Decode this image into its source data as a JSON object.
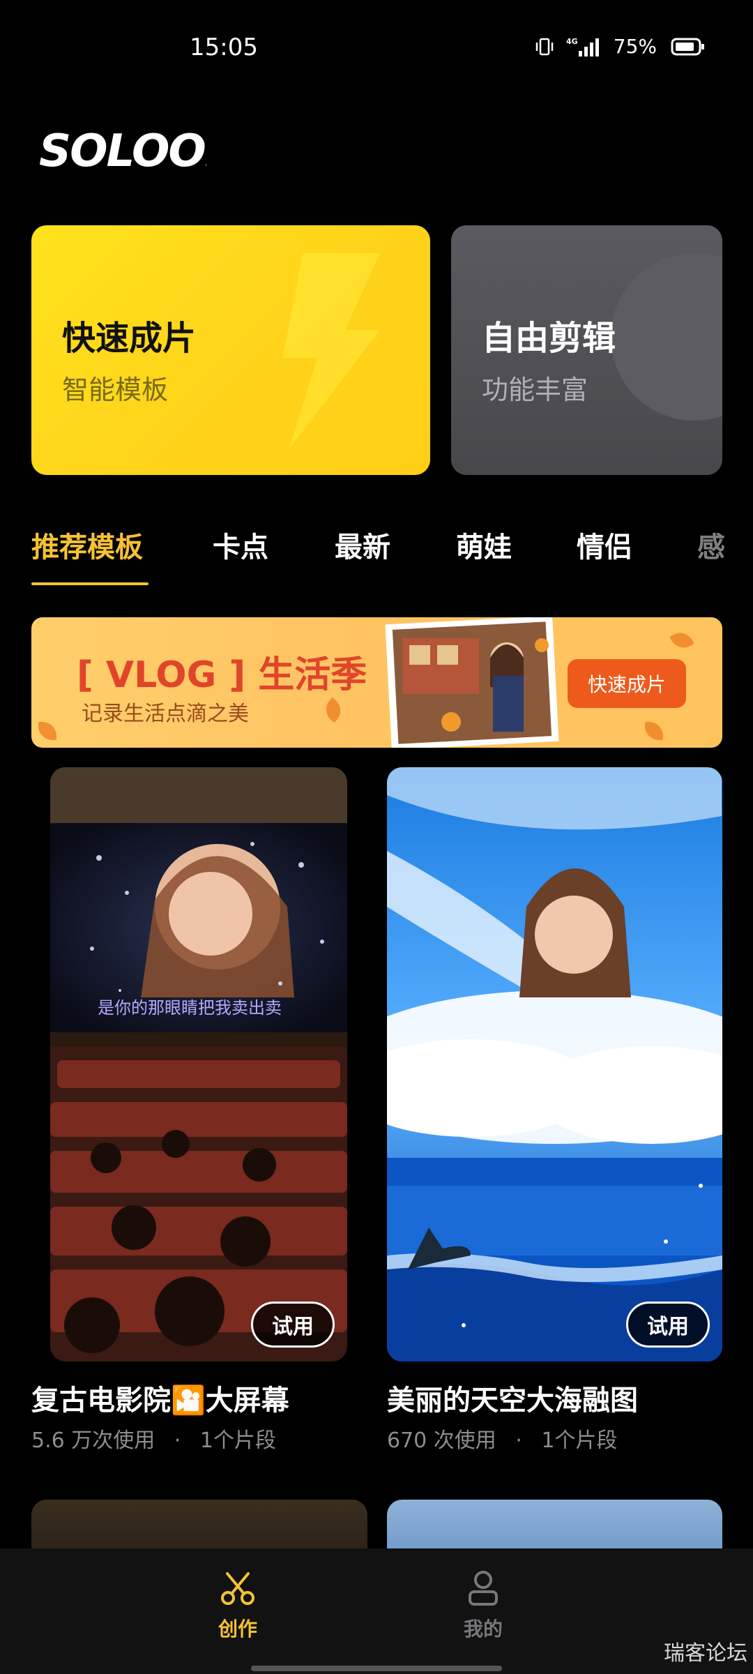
{
  "status_bar": {
    "time": "15:05",
    "battery": "75%",
    "icons": [
      "vibrate-icon",
      "signal-4g-icon",
      "battery-icon"
    ]
  },
  "logo": {
    "text": "SOLOOP"
  },
  "cards": {
    "quick": {
      "title": "快速成片",
      "subtitle": "智能模板",
      "icon": "bolt-icon",
      "color": "#ffe21c"
    },
    "free": {
      "title": "自由剪辑",
      "subtitle": "功能丰富",
      "color": "#55555b"
    }
  },
  "tabs": {
    "items": [
      "推荐模板",
      "卡点",
      "最新",
      "萌娃",
      "情侣",
      "感"
    ],
    "active_index": 0,
    "accent": "#f6c234"
  },
  "banner": {
    "title": "[ VLOG ] 生活季",
    "subtitle": "记录生活点滴之美",
    "button": "快速成片"
  },
  "templates": [
    {
      "name": "复古电影院🎦大屏幕",
      "uses": "5.6 万次使用",
      "separator": "·",
      "segments": "1个片段",
      "try_label": "试用",
      "overlay_text": "是你的那眼睛把我卖出卖"
    },
    {
      "name": "美丽的天空大海融图",
      "uses": "670 次使用",
      "separator": "·",
      "segments": "1个片段",
      "try_label": "试用"
    }
  ],
  "bottom_nav": {
    "items": [
      {
        "label": "创作",
        "icon": "scissors-icon",
        "active": true
      },
      {
        "label": "我的",
        "icon": "user-icon",
        "active": false
      }
    ]
  },
  "watermark": "瑞客论坛"
}
